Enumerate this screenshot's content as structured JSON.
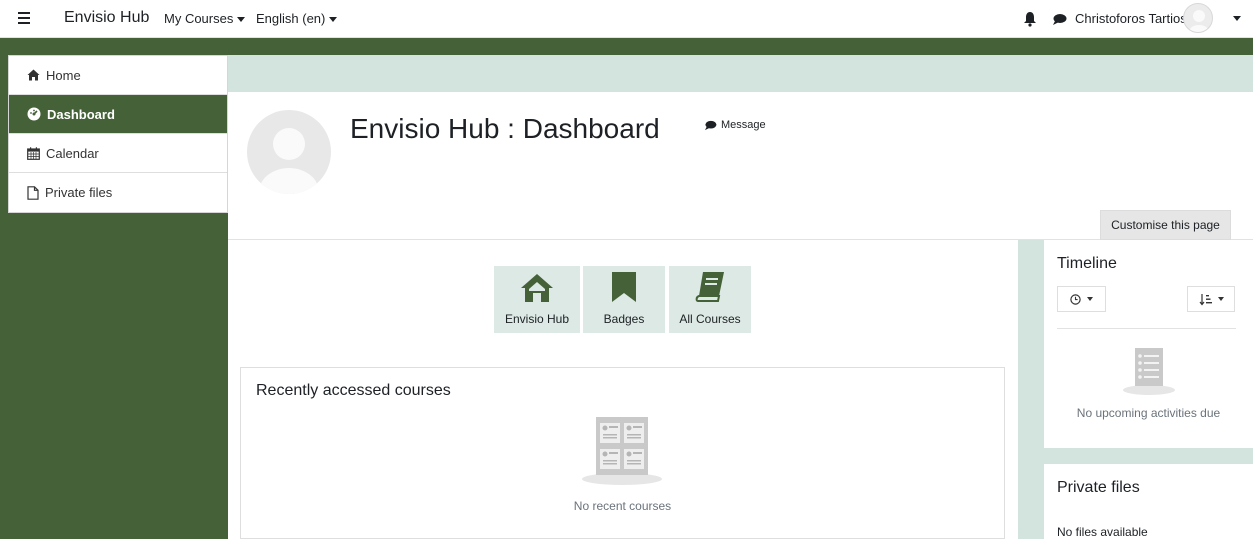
{
  "navbar": {
    "brand": "Envisio Hub",
    "my_courses": "My Courses",
    "language": "English (en)",
    "user_name": "Christoforos Tartios"
  },
  "drawer": {
    "items": [
      {
        "label": "Home",
        "icon": "home-icon",
        "active": false
      },
      {
        "label": "Dashboard",
        "icon": "dashboard-icon",
        "active": true
      },
      {
        "label": "Calendar",
        "icon": "calendar-icon",
        "active": false
      },
      {
        "label": "Private files",
        "icon": "file-icon",
        "active": false
      }
    ]
  },
  "header": {
    "title": "Envisio Hub : Dashboard",
    "message_label": "Message",
    "customise_label": "Customise this page"
  },
  "tiles": [
    {
      "label": "Envisio Hub",
      "icon": "home-icon"
    },
    {
      "label": "Badges",
      "icon": "bookmark-icon"
    },
    {
      "label": "All Courses",
      "icon": "book-icon"
    }
  ],
  "recent": {
    "title": "Recently accessed courses",
    "empty": "No recent courses"
  },
  "timeline": {
    "title": "Timeline",
    "empty": "No upcoming activities due"
  },
  "private_files": {
    "title": "Private files",
    "empty": "No files available"
  },
  "colors": {
    "brand_green": "#456138",
    "accent_light": "#d3e3dd",
    "tile_bg": "#dde9e4"
  }
}
